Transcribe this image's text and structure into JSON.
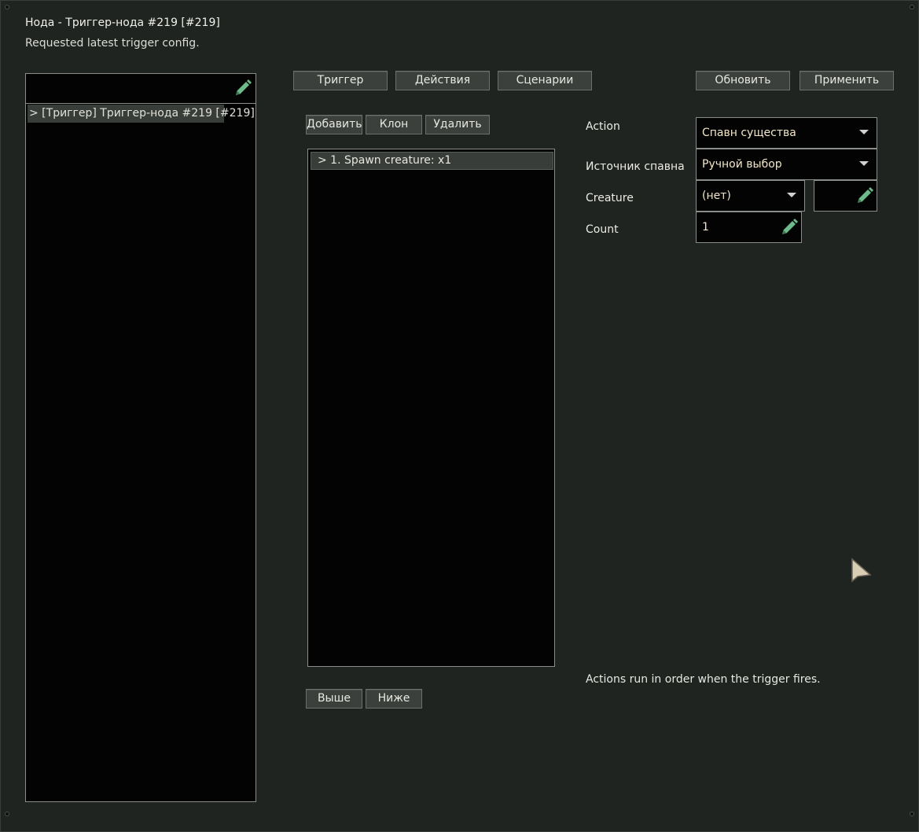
{
  "window": {
    "title": "Нода - Триггер-нода #219 [#219]",
    "status": "Requested latest trigger config."
  },
  "left_panel": {
    "search_value": "",
    "tree_items": [
      {
        "label": "> [Триггер] Триггер-нода #219 [#219]"
      }
    ]
  },
  "tabs": {
    "trigger": "Триггер",
    "actions": "Действия",
    "scenarios": "Сценарии"
  },
  "toolbar": {
    "refresh": "Обновить",
    "apply": "Применить"
  },
  "action_toolbar": {
    "add": "Добавить",
    "clone": "Клон",
    "delete": "Удалить",
    "up": "Выше",
    "down": "Ниже"
  },
  "action_list": {
    "items": [
      {
        "label": "> 1. Spawn creature:  x1"
      }
    ]
  },
  "fields": {
    "action_label": "Action",
    "action_value": "Спавн существа",
    "source_label": "Источник спавна",
    "source_value": "Ручной выбор",
    "creature_label": "Creature",
    "creature_value": "(нет)",
    "count_label": "Count",
    "count_value": "1"
  },
  "hint": "Actions run in order when the trigger fires.",
  "icons": {
    "edit": "pencil-icon",
    "dropdown": "triangle-down-icon",
    "cursor": "arrow-cursor-icon"
  },
  "colors": {
    "accent_green": "#6dba8a",
    "background": "#202421",
    "field_bg": "#030303",
    "value_text": "#f2e6c8"
  }
}
